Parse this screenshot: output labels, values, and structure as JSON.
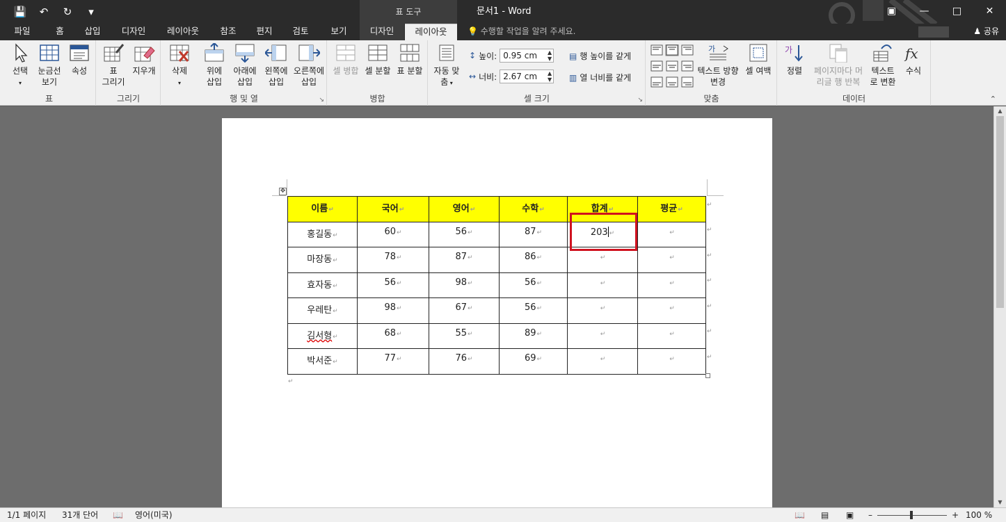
{
  "titlebar": {
    "context_tab": "표 도구",
    "doc_title": "문서1 - Word"
  },
  "tabs": [
    {
      "label": "파일"
    },
    {
      "label": "홈"
    },
    {
      "label": "삽입"
    },
    {
      "label": "디자인"
    },
    {
      "label": "레이아웃"
    },
    {
      "label": "참조"
    },
    {
      "label": "편지"
    },
    {
      "label": "검토"
    },
    {
      "label": "보기"
    },
    {
      "label": "디자인"
    },
    {
      "label": "레이아웃"
    }
  ],
  "tell_me": "수행할 작업을 알려 주세요.",
  "share": "공유",
  "ribbon": {
    "groups": {
      "table": "표",
      "draw": "그리기",
      "rows_cols": "행 및 열",
      "merge": "병합",
      "cell_size": "셀 크기",
      "align": "맞춤",
      "data": "데이터"
    },
    "buttons": {
      "select": "선택",
      "gridlines_1": "눈금선",
      "gridlines_2": "보기",
      "properties": "속성",
      "draw_table_1": "표",
      "draw_table_2": "그리기",
      "eraser": "지우개",
      "delete": "삭제",
      "insert_above_1": "위에",
      "insert_above_2": "삽입",
      "insert_below_1": "아래에",
      "insert_below_2": "삽입",
      "insert_left_1": "왼쪽에",
      "insert_left_2": "삽입",
      "insert_right_1": "오른쪽에",
      "insert_right_2": "삽입",
      "merge_cells": "셀 병합",
      "split_cells": "셀 분할",
      "split_table": "표 분할",
      "autofit_1": "자동 맞",
      "autofit_2": "춤",
      "height_label": "높이:",
      "height_value": "0.95 cm",
      "width_label": "너비:",
      "width_value": "2.67 cm",
      "distribute_rows": "행 높이를 같게",
      "distribute_cols": "열 너비를 같게",
      "text_direction_1": "텍스트 방향",
      "text_direction_2": "변경",
      "cell_margins": "셀 여백",
      "sort": "정렬",
      "repeat_header_1": "페이지마다 머",
      "repeat_header_2": "리글 행 반복",
      "convert_text_1": "텍스트",
      "convert_text_2": "로 변환",
      "formula": "수식"
    }
  },
  "table": {
    "headers": [
      "이름",
      "국어",
      "영어",
      "수학",
      "합계",
      "평균"
    ],
    "rows": [
      [
        "홍길동",
        "60",
        "56",
        "87",
        "203",
        ""
      ],
      [
        "마장동",
        "78",
        "87",
        "86",
        "",
        ""
      ],
      [
        "효자동",
        "56",
        "98",
        "56",
        "",
        ""
      ],
      [
        "우레탄",
        "98",
        "67",
        "56",
        "",
        ""
      ],
      [
        "김서형",
        "68",
        "55",
        "89",
        "",
        ""
      ],
      [
        "박서준",
        "77",
        "76",
        "69",
        "",
        ""
      ]
    ]
  },
  "statusbar": {
    "pages": "1/1 페이지",
    "words": "31개 단어",
    "language": "영어(미국)",
    "zoom": "100 %"
  },
  "colors": {
    "header_fill": "#ffff00",
    "highlight_border": "#d0121f",
    "titlebar_bg": "#2b2b2b"
  }
}
